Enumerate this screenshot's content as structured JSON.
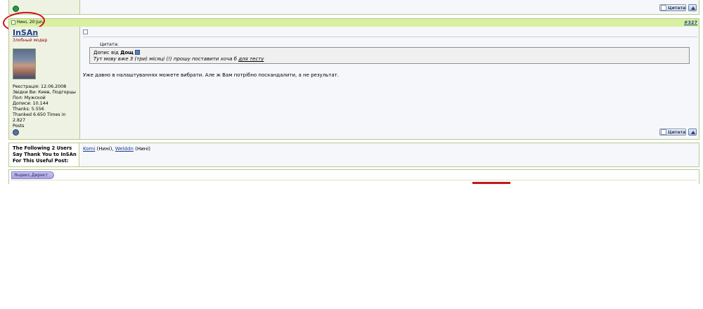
{
  "prev_post": {
    "quote_button": "Цитата"
  },
  "post": {
    "header": {
      "date": "Нині, 20:Jun",
      "post_number": "#327"
    },
    "user": {
      "name": "InSAn",
      "title": "Злобный модер",
      "stats": [
        "Реєстрація: 12.06.2008",
        "Звідки Ви: Киев, Подгорцы",
        "Пол: Мужской",
        "Дописи: 10.144",
        "Thanks: 5.556",
        "Thanked 6.650 Times in 2.827",
        "Posts"
      ]
    },
    "quote": {
      "label": "Цитата:",
      "author_prefix": "Допис від",
      "author": "Дощ",
      "text": "Тут мову вже 3 (три) місяці (!) прошу поставити хоча б",
      "link_text": "для тесту"
    },
    "message": "Уже давно в налаштуваннях можете вибрати. Але ж Вам потрібно поскандалити, а не результат.",
    "quote_button": "Цитата"
  },
  "thanks": {
    "label_lines": [
      "The Following 2 Users",
      "Say Thank You to InSAn",
      "For This Useful Post:"
    ],
    "users": [
      {
        "name": "Komi",
        "when": "(Нині)"
      },
      {
        "name": "Welddn",
        "when": "(Нині)"
      }
    ],
    "separator": ","
  },
  "ads": {
    "label": "Яндекс.Директ"
  },
  "colors": {
    "header_bar": "#d8f0a0",
    "border": "#b7c98f",
    "annotation": "#cc1111",
    "online_green": "#1e9e3e",
    "offline_blue": "#5a6fa3"
  }
}
